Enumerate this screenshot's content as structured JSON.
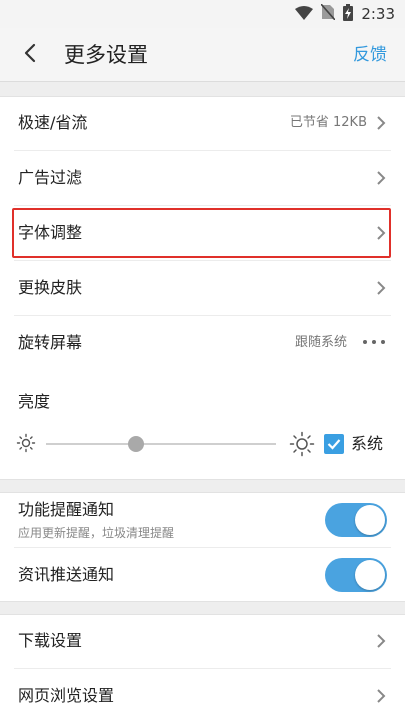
{
  "status": {
    "time": "2:33",
    "icons": [
      "wifi-icon",
      "sim-off-icon",
      "battery-charging-icon"
    ]
  },
  "header": {
    "title": "更多设置",
    "feedback": "反馈",
    "back_icon": "back-arrow-icon"
  },
  "section1": {
    "speed": {
      "label": "极速/省流",
      "value": "已节省 12KB"
    },
    "adblock": {
      "label": "广告过滤"
    },
    "font": {
      "label": "字体调整"
    },
    "skin": {
      "label": "更换皮肤"
    },
    "rotate": {
      "label": "旋转屏幕",
      "value": "跟随系统"
    },
    "brightness": {
      "label": "亮度",
      "slider_level": 0.39,
      "system_label": "系统",
      "system_checked": true
    }
  },
  "section2": {
    "feature_notify": {
      "label": "功能提醒通知",
      "sublabel": "应用更新提醒，垃圾清理提醒",
      "enabled": true
    },
    "news_notify": {
      "label": "资讯推送通知",
      "enabled": true
    }
  },
  "section3": {
    "download": {
      "label": "下载设置"
    },
    "browse": {
      "label": "网页浏览设置"
    }
  },
  "colors": {
    "accent": "#3a9fe2",
    "highlight_border": "#e0302a"
  }
}
